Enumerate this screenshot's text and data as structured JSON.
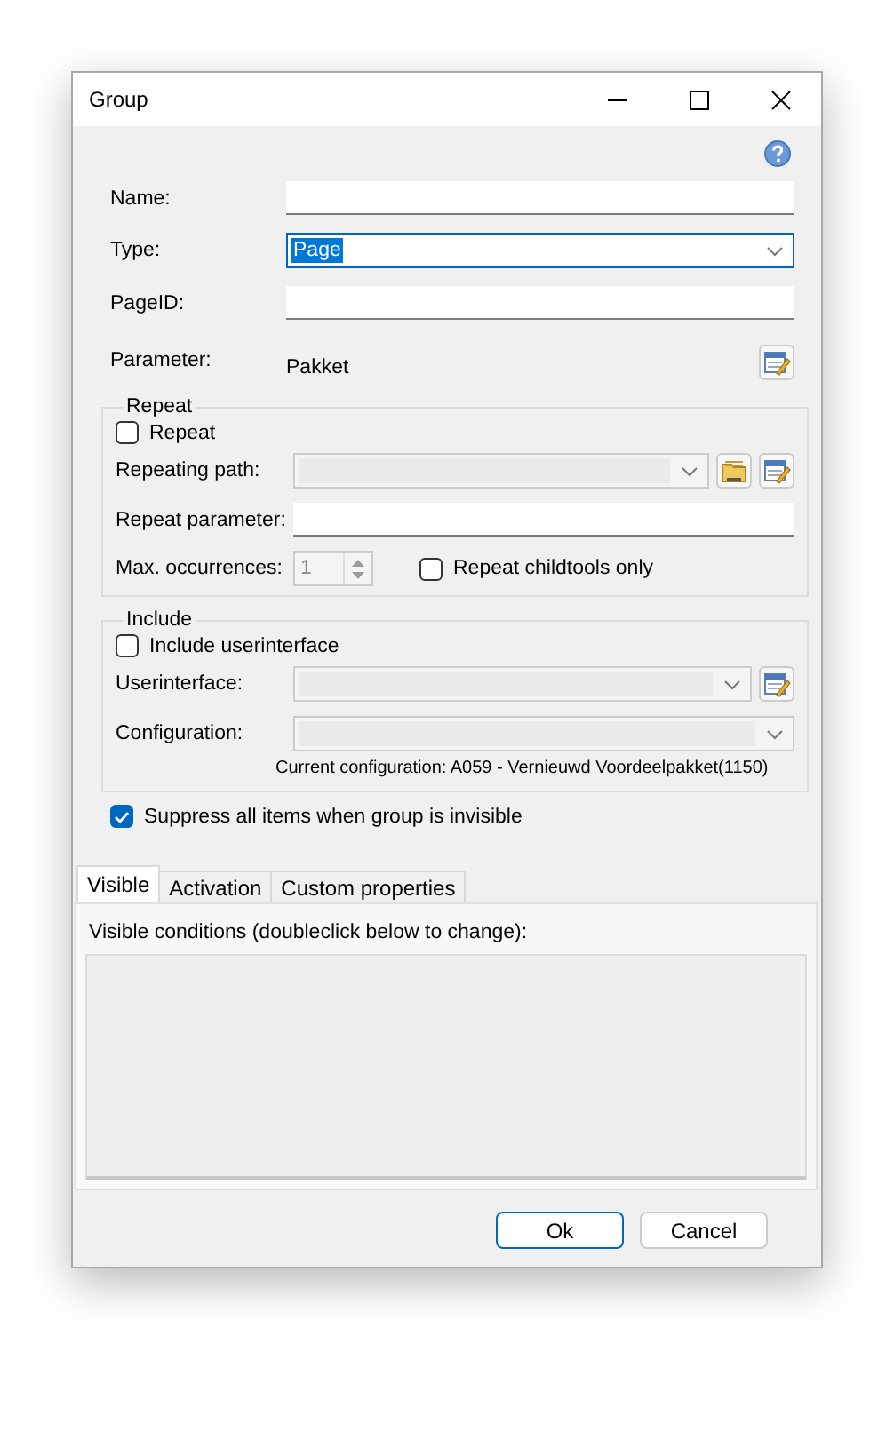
{
  "window": {
    "title": "Group"
  },
  "fields": [
    {
      "label": "Name:",
      "kind": "text"
    },
    {
      "label": "Type:",
      "kind": "combo",
      "value": "Page",
      "highlighted": true
    },
    {
      "label": "PageID:",
      "kind": "text"
    }
  ],
  "parameter": {
    "label": "Parameter:",
    "value": "Pakket"
  },
  "repeat": {
    "title": "Repeat",
    "checkbox": {
      "label": "Repeat",
      "checked": false
    },
    "repeating_path": {
      "label": "Repeating path:",
      "disabled": true
    },
    "repeat_parameter": {
      "label": "Repeat parameter:"
    },
    "max_occurrences": {
      "label": "Max. occurrences:",
      "value": "1",
      "disabled": true
    },
    "childtools": {
      "label": "Repeat childtools only",
      "checked": false
    }
  },
  "include": {
    "title": "Include",
    "checkbox": {
      "label": "Include userinterface",
      "checked": false
    },
    "userinterface": {
      "label": "Userinterface:",
      "disabled": true
    },
    "configuration": {
      "label": "Configuration:",
      "disabled": true
    },
    "current_configuration": "Current configuration: A059 - Vernieuwd Voordeelpakket(1150)"
  },
  "suppress": {
    "label": "Suppress all items when group is invisible",
    "checked": true
  },
  "tabs": [
    {
      "label": "Visible",
      "selected": true
    },
    {
      "label": "Activation",
      "selected": false
    },
    {
      "label": "Custom properties",
      "selected": false
    }
  ],
  "tab_panel": {
    "caption": "Visible conditions (doubleclick below to change):"
  },
  "buttons": [
    {
      "label": "Ok",
      "default": true
    },
    {
      "label": "Cancel",
      "default": false
    }
  ]
}
